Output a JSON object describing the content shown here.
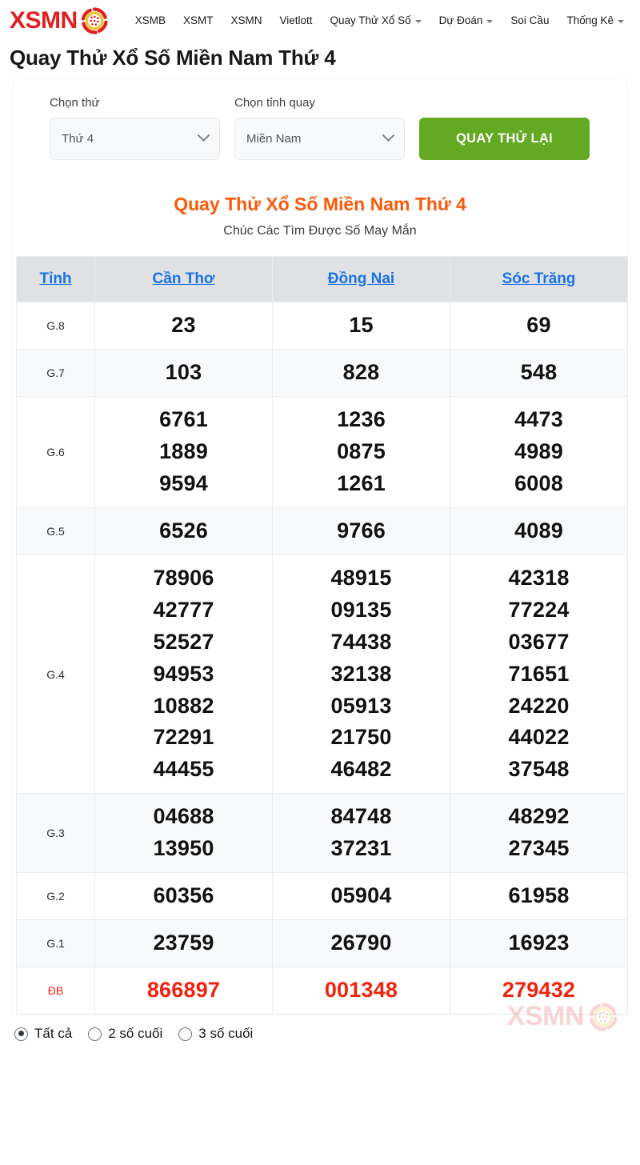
{
  "header": {
    "logo_text": "XSMN",
    "logo_icon": "lottery-ball-icon",
    "nav": [
      {
        "label": "XSMB",
        "caret": false
      },
      {
        "label": "XSMT",
        "caret": false
      },
      {
        "label": "XSMN",
        "caret": false
      },
      {
        "label": "Vietlott",
        "caret": false
      },
      {
        "label": "Quay Thử Xổ Số",
        "caret": true
      },
      {
        "label": "Dự Đoán",
        "caret": true
      },
      {
        "label": "Soi Cầu",
        "caret": false
      },
      {
        "label": "Thống Kê",
        "caret": true
      }
    ]
  },
  "page_title": "Quay Thử Xổ Số Miền Nam Thứ 4",
  "controls": {
    "day_label": "Chọn thứ",
    "day_value": "Thứ 4",
    "province_label": "Chọn tỉnh quay",
    "province_value": "Miền Nam",
    "spin_button": "QUAY THỬ LẠI",
    "accent_green": "#63a921"
  },
  "result": {
    "heading": "Quay Thử Xổ Số Miền Nam Thứ 4",
    "heading_color": "#fa5a0a",
    "subtitle": "Chúc Các Tìm Được Số May Mắn"
  },
  "table": {
    "headers": [
      "Tỉnh",
      "Cần Thơ",
      "Đồng Nai",
      "Sóc Trăng"
    ],
    "header_link_color": "#1a73e8",
    "db_color": "#f0230d",
    "rows": [
      {
        "label": "G.8",
        "zebra": false,
        "values": [
          [
            "23"
          ],
          [
            "15"
          ],
          [
            "69"
          ]
        ]
      },
      {
        "label": "G.7",
        "zebra": true,
        "values": [
          [
            "103"
          ],
          [
            "828"
          ],
          [
            "548"
          ]
        ]
      },
      {
        "label": "G.6",
        "zebra": false,
        "values": [
          [
            "6761",
            "1889",
            "9594"
          ],
          [
            "1236",
            "0875",
            "1261"
          ],
          [
            "4473",
            "4989",
            "6008"
          ]
        ]
      },
      {
        "label": "G.5",
        "zebra": true,
        "values": [
          [
            "6526"
          ],
          [
            "9766"
          ],
          [
            "4089"
          ]
        ]
      },
      {
        "label": "G.4",
        "zebra": false,
        "values": [
          [
            "78906",
            "42777",
            "52527",
            "94953",
            "10882",
            "72291",
            "44455"
          ],
          [
            "48915",
            "09135",
            "74438",
            "32138",
            "05913",
            "21750",
            "46482"
          ],
          [
            "42318",
            "77224",
            "03677",
            "71651",
            "24220",
            "44022",
            "37548"
          ]
        ]
      },
      {
        "label": "G.3",
        "zebra": true,
        "values": [
          [
            "04688",
            "13950"
          ],
          [
            "84748",
            "37231"
          ],
          [
            "48292",
            "27345"
          ]
        ]
      },
      {
        "label": "G.2",
        "zebra": false,
        "values": [
          [
            "60356"
          ],
          [
            "05904"
          ],
          [
            "61958"
          ]
        ]
      },
      {
        "label": "G.1",
        "zebra": true,
        "values": [
          [
            "23759"
          ],
          [
            "26790"
          ],
          [
            "16923"
          ]
        ]
      },
      {
        "label": "ĐB",
        "zebra": false,
        "db": true,
        "values": [
          [
            "866897"
          ],
          [
            "001348"
          ],
          [
            "279432"
          ]
        ]
      }
    ]
  },
  "watermark": {
    "text": "XSMN",
    "icon": "lottery-ball-icon"
  },
  "filters": [
    {
      "label": "Tất cả",
      "checked": true
    },
    {
      "label": "2 số cuối",
      "checked": false
    },
    {
      "label": "3 số cuối",
      "checked": false
    }
  ]
}
